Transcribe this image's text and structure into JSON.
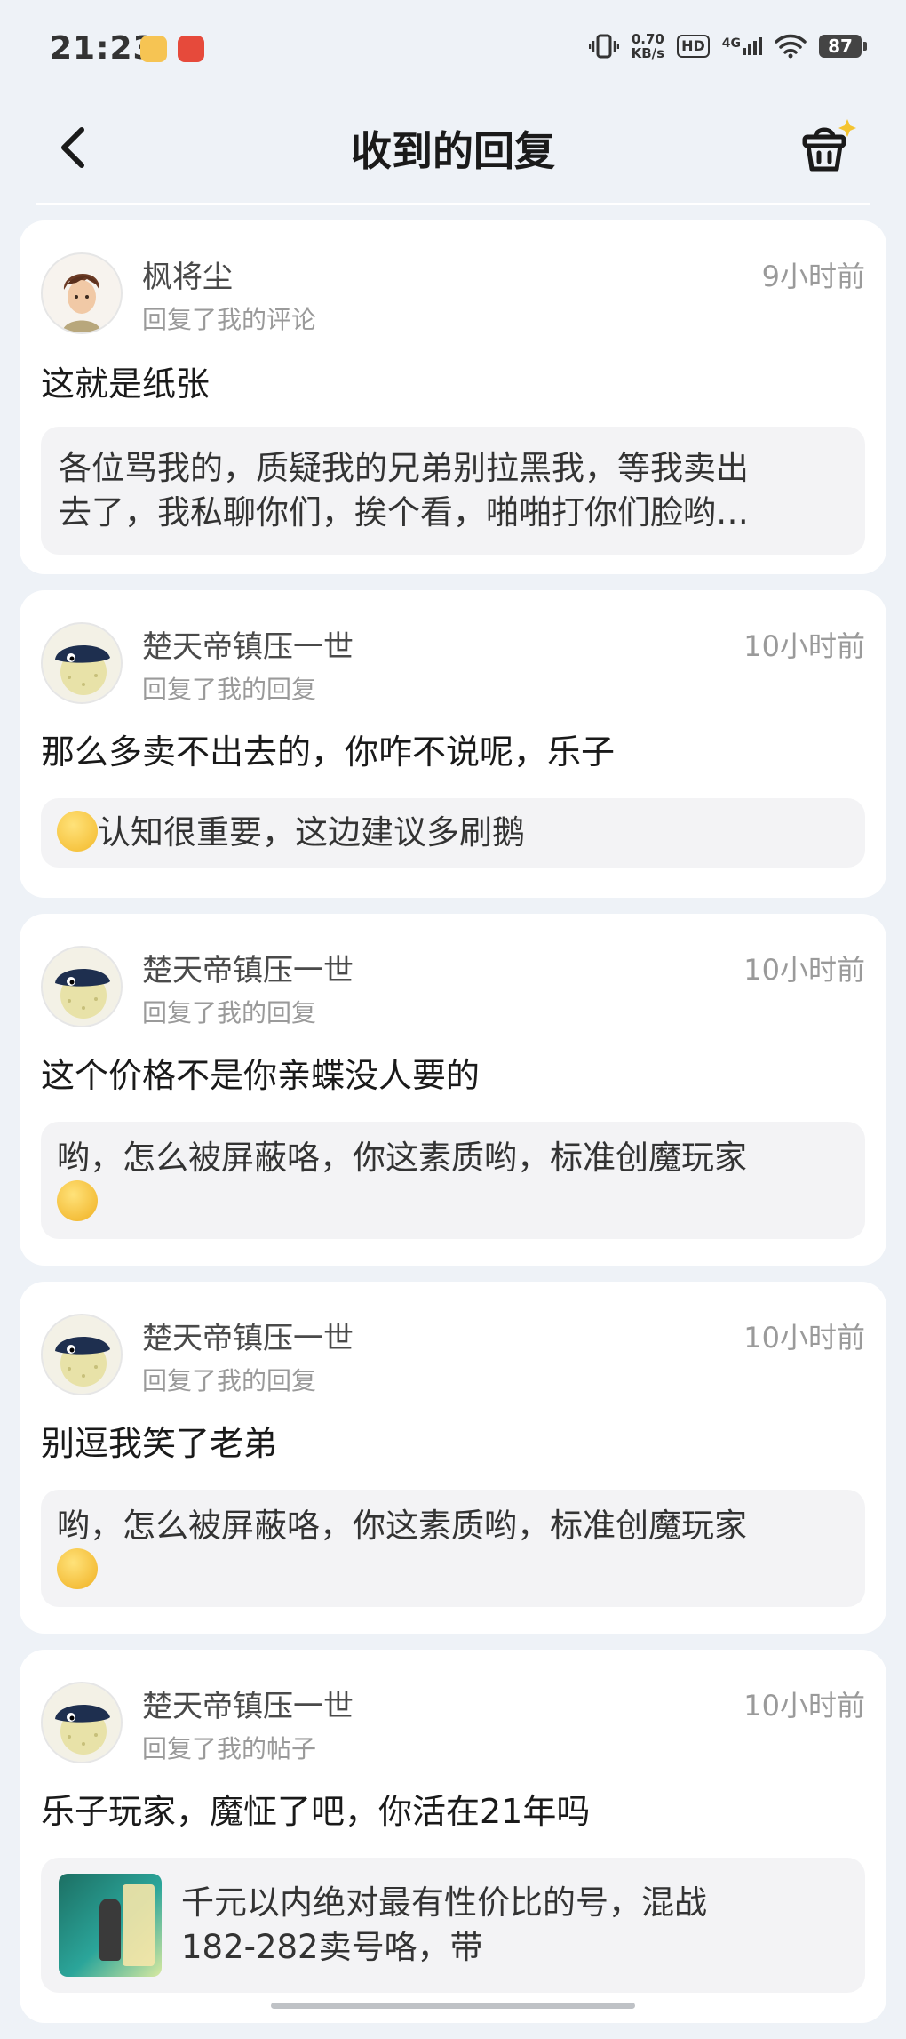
{
  "status": {
    "time": "21:23",
    "speed_value": "0.70",
    "speed_unit": "KB/s",
    "hd": "HD",
    "network": "4G",
    "battery": "87"
  },
  "nav": {
    "title": "收到的回复",
    "back_icon": "chevron-left-icon",
    "right_icon": "basket-sparkle-icon"
  },
  "replies": [
    {
      "user": "枫将尘",
      "action": "回复了我的评论",
      "time": "9小时前",
      "text": "这就是纸张",
      "quote_lines": [
        "各位骂我的，质疑我的兄弟别拉黑我，等我卖出",
        "去了，我私聊你们，挨个看，啪啪打你们脸哟…"
      ]
    },
    {
      "user": "楚天帝镇压一世",
      "action": "回复了我的回复",
      "time": "10小时前",
      "text": "那么多卖不出去的，你咋不说呢，乐子",
      "quote_text": "认知很重要，这边建议多刷鹅"
    },
    {
      "user": "楚天帝镇压一世",
      "action": "回复了我的回复",
      "time": "10小时前",
      "text": "这个价格不是你亲蝶没人要的",
      "quote_text": "哟，怎么被屏蔽咯，你这素质哟，标准创魔玩家"
    },
    {
      "user": "楚天帝镇压一世",
      "action": "回复了我的回复",
      "time": "10小时前",
      "text": "别逗我笑了老弟",
      "quote_text": "哟，怎么被屏蔽咯，你这素质哟，标准创魔玩家"
    },
    {
      "user": "楚天帝镇压一世",
      "action": "回复了我的帖子",
      "time": "10小时前",
      "text": "乐子玩家，魔怔了吧，你活在21年吗",
      "quote_lines": [
        "千元以内绝对最有性价比的号，混战",
        "182-282卖号咯，带"
      ]
    }
  ]
}
